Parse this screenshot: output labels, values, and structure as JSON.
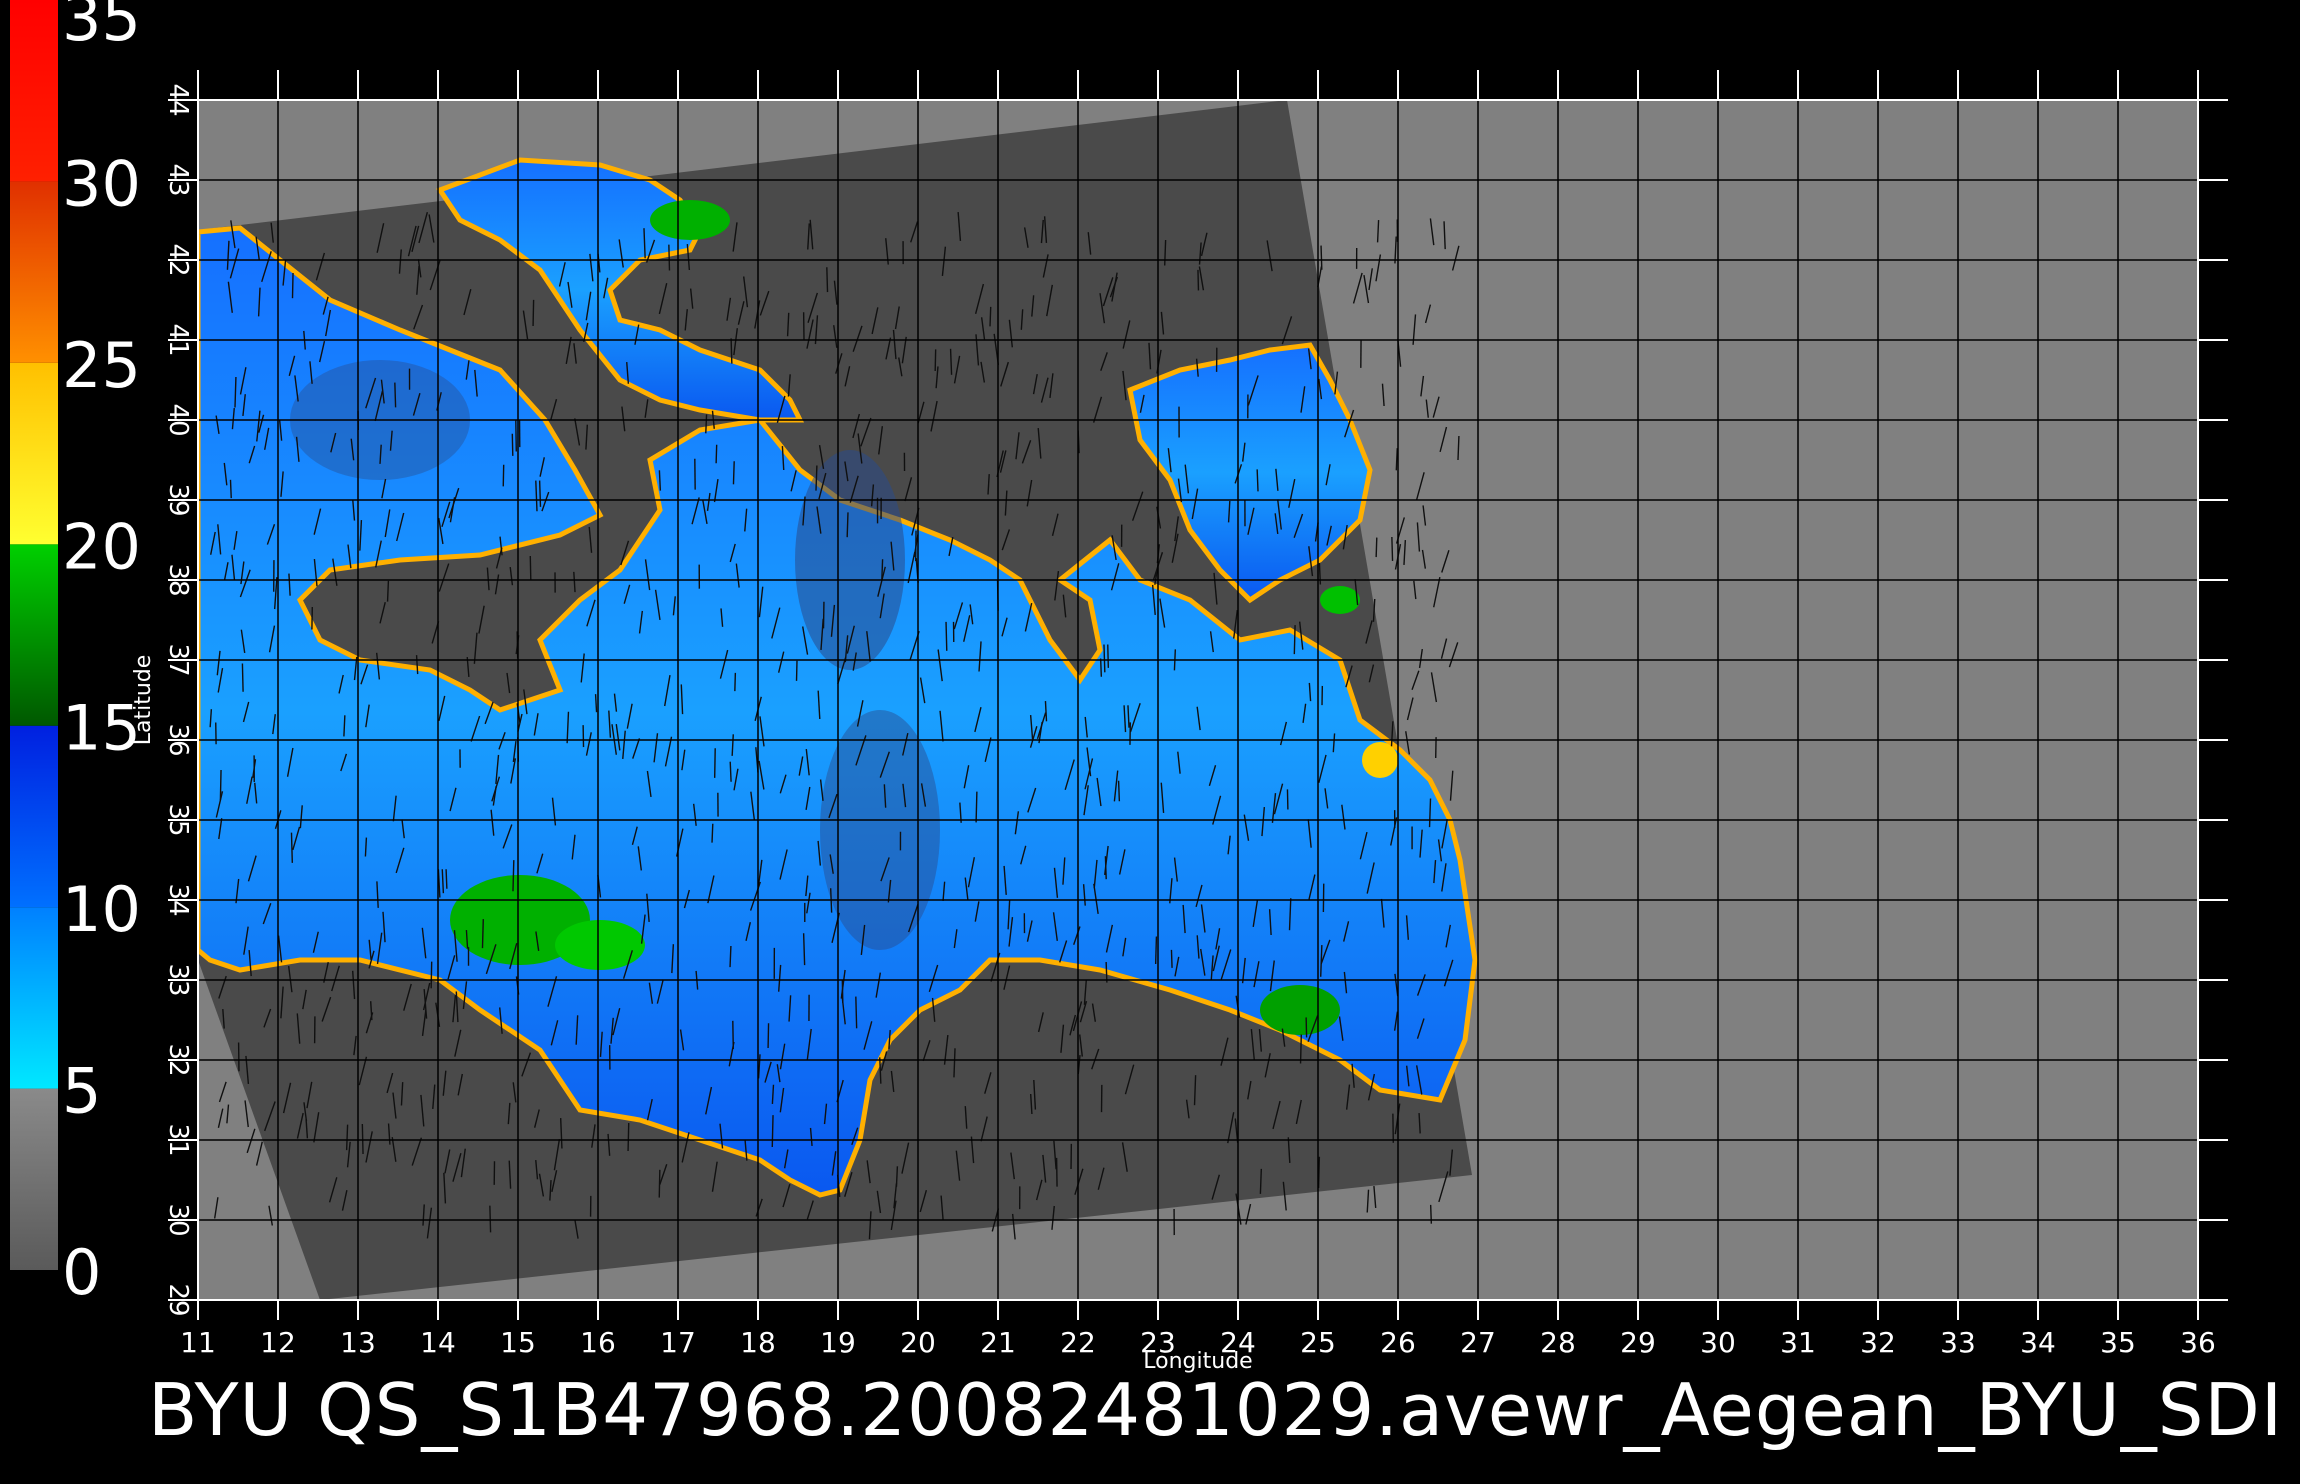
{
  "map": {
    "xlabel": "Longitude",
    "ylabel": "Latitude",
    "lon_range": [
      11,
      36
    ],
    "lat_range": [
      29,
      44
    ],
    "lon_ticks": [
      "11",
      "12",
      "13",
      "14",
      "15",
      "16",
      "17",
      "18",
      "19",
      "20",
      "21",
      "22",
      "23",
      "24",
      "25",
      "26",
      "27",
      "28",
      "29",
      "30",
      "31",
      "32",
      "33",
      "34",
      "35",
      "36"
    ],
    "lat_ticks": [
      "29",
      "30",
      "31",
      "32",
      "33",
      "34",
      "35",
      "36",
      "37",
      "38",
      "39",
      "40",
      "41",
      "42",
      "43",
      "44"
    ],
    "colors": {
      "land": "#4a4a4a",
      "outside_swath": "#808080",
      "background": "#000000",
      "grid": "#000000"
    }
  },
  "colorbar": {
    "range": [
      0,
      35
    ],
    "tick_labels": [
      "0",
      "5",
      "10",
      "15",
      "20",
      "25",
      "30",
      "35"
    ],
    "stops": [
      {
        "from": 0,
        "to": 5,
        "colors": [
          "#5a5a5a",
          "#8a8a8a"
        ]
      },
      {
        "from": 5,
        "to": 10,
        "colors": [
          "#00e8ff",
          "#0080ff"
        ]
      },
      {
        "from": 10,
        "to": 15,
        "colors": [
          "#0070ff",
          "#0020e0"
        ]
      },
      {
        "from": 15,
        "to": 20,
        "colors": [
          "#005800",
          "#00d000"
        ]
      },
      {
        "from": 20,
        "to": 25,
        "colors": [
          "#ffff30",
          "#ffc000"
        ]
      },
      {
        "from": 25,
        "to": 30,
        "colors": [
          "#ff9000",
          "#e03000"
        ]
      },
      {
        "from": 30,
        "to": 35,
        "colors": [
          "#ff2000",
          "#ff0000"
        ]
      }
    ]
  },
  "footer_text": "BYU  QS_S1B47968.20082481029.avewr_Aegean_BYU_SDI"
}
